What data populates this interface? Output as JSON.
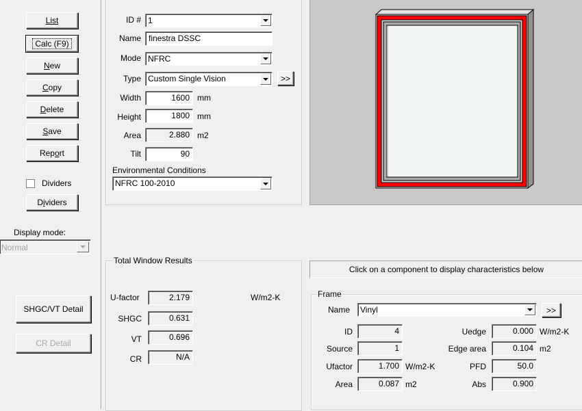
{
  "sidebar": {
    "list_label": "List",
    "calc_label": "Calc (F9)",
    "new_label": "New",
    "copy_label": "Copy",
    "delete_label": "Delete",
    "save_label": "Save",
    "report_label": "Report",
    "dividers_checkbox_label": "Dividers",
    "dividers_checked": false,
    "dividers_button_label": "Dividers",
    "display_mode_label": "Display mode:",
    "display_mode_value": "Normal",
    "shgc_vt_detail_label": "SHGC/VT Detail",
    "cr_detail_label": "CR Detail"
  },
  "window_props": {
    "id_label": "ID #",
    "id_value": "1",
    "name_label": "Name",
    "name_value": "finestra DSSC",
    "mode_label": "Mode",
    "mode_value": "NFRC",
    "type_label": "Type",
    "type_value": "Custom Single Vision",
    "type_more_label": ">>",
    "width_label": "Width",
    "width_value": "1600",
    "width_unit": "mm",
    "height_label": "Height",
    "height_value": "1800",
    "height_unit": "mm",
    "area_label": "Area",
    "area_value": "2.880",
    "area_unit": "m2",
    "tilt_label": "Tilt",
    "tilt_value": "90",
    "env_label": "Environmental Conditions",
    "env_value": "NFRC 100-2010"
  },
  "results": {
    "title": "Total Window Results",
    "ufactor_label": "U-factor",
    "ufactor_value": "2.179",
    "ufactor_unit": "W/m2-K",
    "shgc_label": "SHGC",
    "shgc_value": "0.631",
    "vt_label": "VT",
    "vt_value": "0.696",
    "cr_label": "CR",
    "cr_value": "N/A"
  },
  "component": {
    "hint": "Click on a component to display characteristics below"
  },
  "frame": {
    "title": "Frame",
    "name_label": "Name",
    "name_value": "Vinyl",
    "more_label": ">>",
    "id_label": "ID",
    "id_value": "4",
    "source_label": "Source",
    "source_value": "1",
    "ufactor_label": "Ufactor",
    "ufactor_value": "1.700",
    "ufactor_unit": "W/m2-K",
    "area_label": "Area",
    "area_value": "0.087",
    "area_unit": "m2",
    "uedge_label": "Uedge",
    "uedge_value": "0.000",
    "uedge_unit": "W/m2-K",
    "edge_area_label": "Edge area",
    "edge_area_value": "0.104",
    "edge_area_unit": "m2",
    "pfd_label": "PFD",
    "pfd_value": "50.0",
    "abs_label": "Abs",
    "abs_value": "0.900"
  },
  "colors": {
    "frame_highlight": "#ff0000",
    "preview_bg": "#c8c8c8",
    "glass": "#f2f6f2"
  }
}
